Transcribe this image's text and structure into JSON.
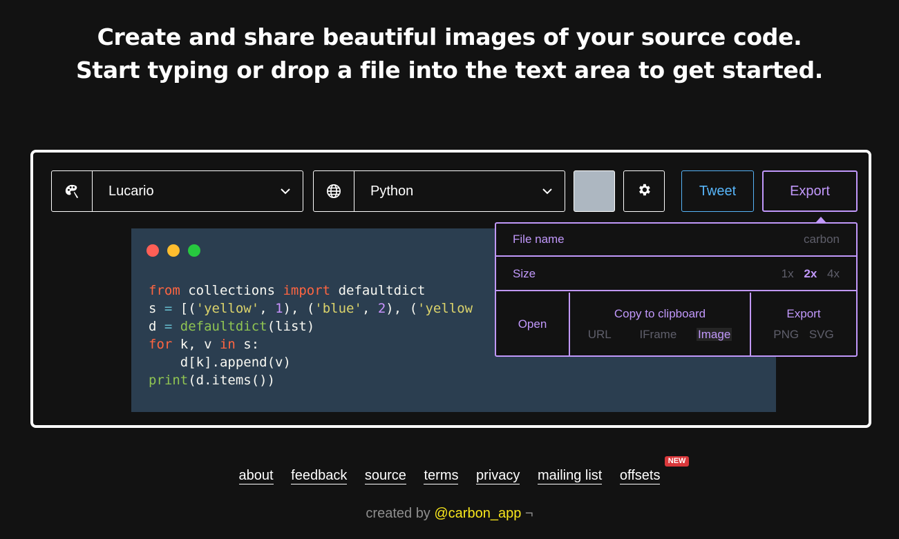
{
  "headline": {
    "line1": "Create and share beautiful images of your source code.",
    "line2": "Start typing or drop a file into the text area to get started."
  },
  "toolbar": {
    "theme": {
      "icon": "palette-icon",
      "value": "Lucario"
    },
    "language": {
      "icon": "globe-icon",
      "value": "Python"
    },
    "background_color": "#adb7c1",
    "settings_icon": "gear-icon",
    "tweet_label": "Tweet",
    "export_label": "Export"
  },
  "window_controls": [
    "#ff5f56",
    "#ffbd2e",
    "#27c93f"
  ],
  "code_lines": [
    "from collections import defaultdict",
    "s = [('yellow', 1), ('blue', 2), ('yellow",
    "d = defaultdict(list)",
    "for k, v in s:",
    "    d[k].append(v)",
    "print(d.items())"
  ],
  "export_menu": {
    "file_name_label": "File name",
    "file_name_placeholder": "carbon",
    "size_label": "Size",
    "sizes": [
      "1x",
      "2x",
      "4x"
    ],
    "selected_size": "2x",
    "open_label": "Open",
    "copy_label": "Copy to clipboard",
    "copy_options": [
      "URL",
      "IFrame",
      "Image"
    ],
    "export_label": "Export",
    "export_formats": [
      "PNG",
      "SVG"
    ]
  },
  "footer": {
    "links": [
      "about",
      "feedback",
      "source",
      "terms",
      "privacy",
      "mailing list",
      "offsets"
    ],
    "new_badge": "NEW",
    "credit_prefix": "created by",
    "credit_handle": "@carbon_app",
    "credit_suffix": "¬"
  },
  "colors": {
    "accent": "#c198fb",
    "tweet": "#57b5f9",
    "code_bg": "#2b3e50",
    "page_bg": "#121212"
  }
}
